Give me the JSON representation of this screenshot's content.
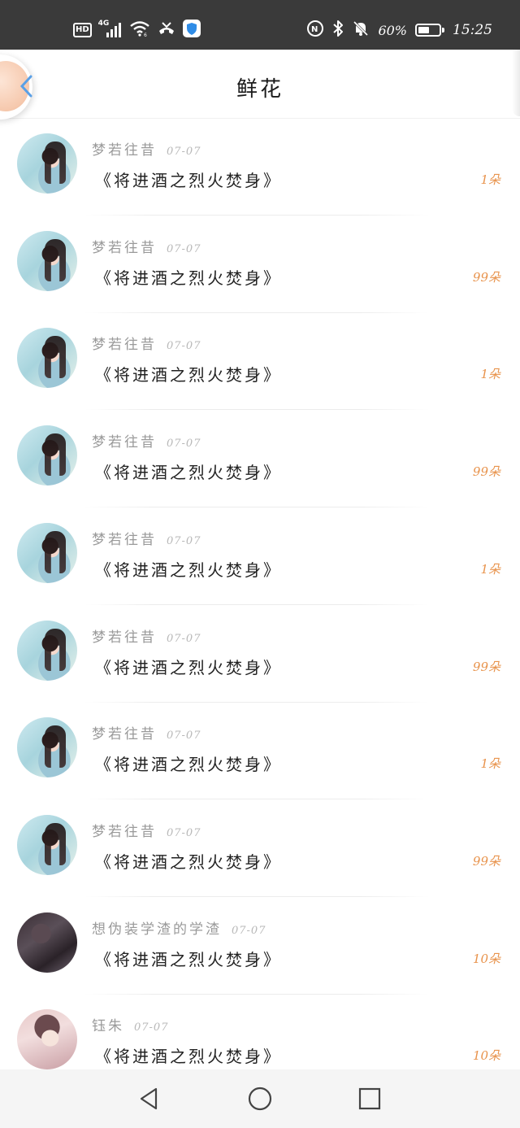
{
  "status_bar": {
    "hd": "HD",
    "network_gen": "4G",
    "battery_percent": "60%",
    "battery_level": 0.6,
    "time": "15:25",
    "icons": [
      "hd-icon",
      "cellular-signal-icon",
      "wifi-icon",
      "missed-call-icon",
      "security-shield-icon",
      "nfc-icon",
      "bluetooth-icon",
      "mute-bell-icon",
      "battery-icon"
    ]
  },
  "header": {
    "title": "鲜花"
  },
  "items": [
    {
      "username": "梦若往昔",
      "date": "07-07",
      "title": "《将进酒之烈火焚身》",
      "count": "1朵",
      "avatar": "style-a"
    },
    {
      "username": "梦若往昔",
      "date": "07-07",
      "title": "《将进酒之烈火焚身》",
      "count": "99朵",
      "avatar": "style-a"
    },
    {
      "username": "梦若往昔",
      "date": "07-07",
      "title": "《将进酒之烈火焚身》",
      "count": "1朵",
      "avatar": "style-a"
    },
    {
      "username": "梦若往昔",
      "date": "07-07",
      "title": "《将进酒之烈火焚身》",
      "count": "99朵",
      "avatar": "style-a"
    },
    {
      "username": "梦若往昔",
      "date": "07-07",
      "title": "《将进酒之烈火焚身》",
      "count": "1朵",
      "avatar": "style-a"
    },
    {
      "username": "梦若往昔",
      "date": "07-07",
      "title": "《将进酒之烈火焚身》",
      "count": "99朵",
      "avatar": "style-a"
    },
    {
      "username": "梦若往昔",
      "date": "07-07",
      "title": "《将进酒之烈火焚身》",
      "count": "1朵",
      "avatar": "style-a"
    },
    {
      "username": "梦若往昔",
      "date": "07-07",
      "title": "《将进酒之烈火焚身》",
      "count": "99朵",
      "avatar": "style-a"
    },
    {
      "username": "想伪装学渣的学渣",
      "date": "07-07",
      "title": "《将进酒之烈火焚身》",
      "count": "10朵",
      "avatar": "style-b"
    },
    {
      "username": "钰朱",
      "date": "07-07",
      "title": "《将进酒之烈火焚身》",
      "count": "10朵",
      "avatar": "style-c"
    }
  ],
  "colors": {
    "status_bar_bg": "#3a3a3a",
    "count_accent": "#e8934c",
    "back_arrow": "#5aa0e6",
    "username_gray": "#9a9a9a"
  },
  "nav": {
    "icons": [
      "nav-back-icon",
      "nav-home-icon",
      "nav-recent-icon"
    ]
  }
}
